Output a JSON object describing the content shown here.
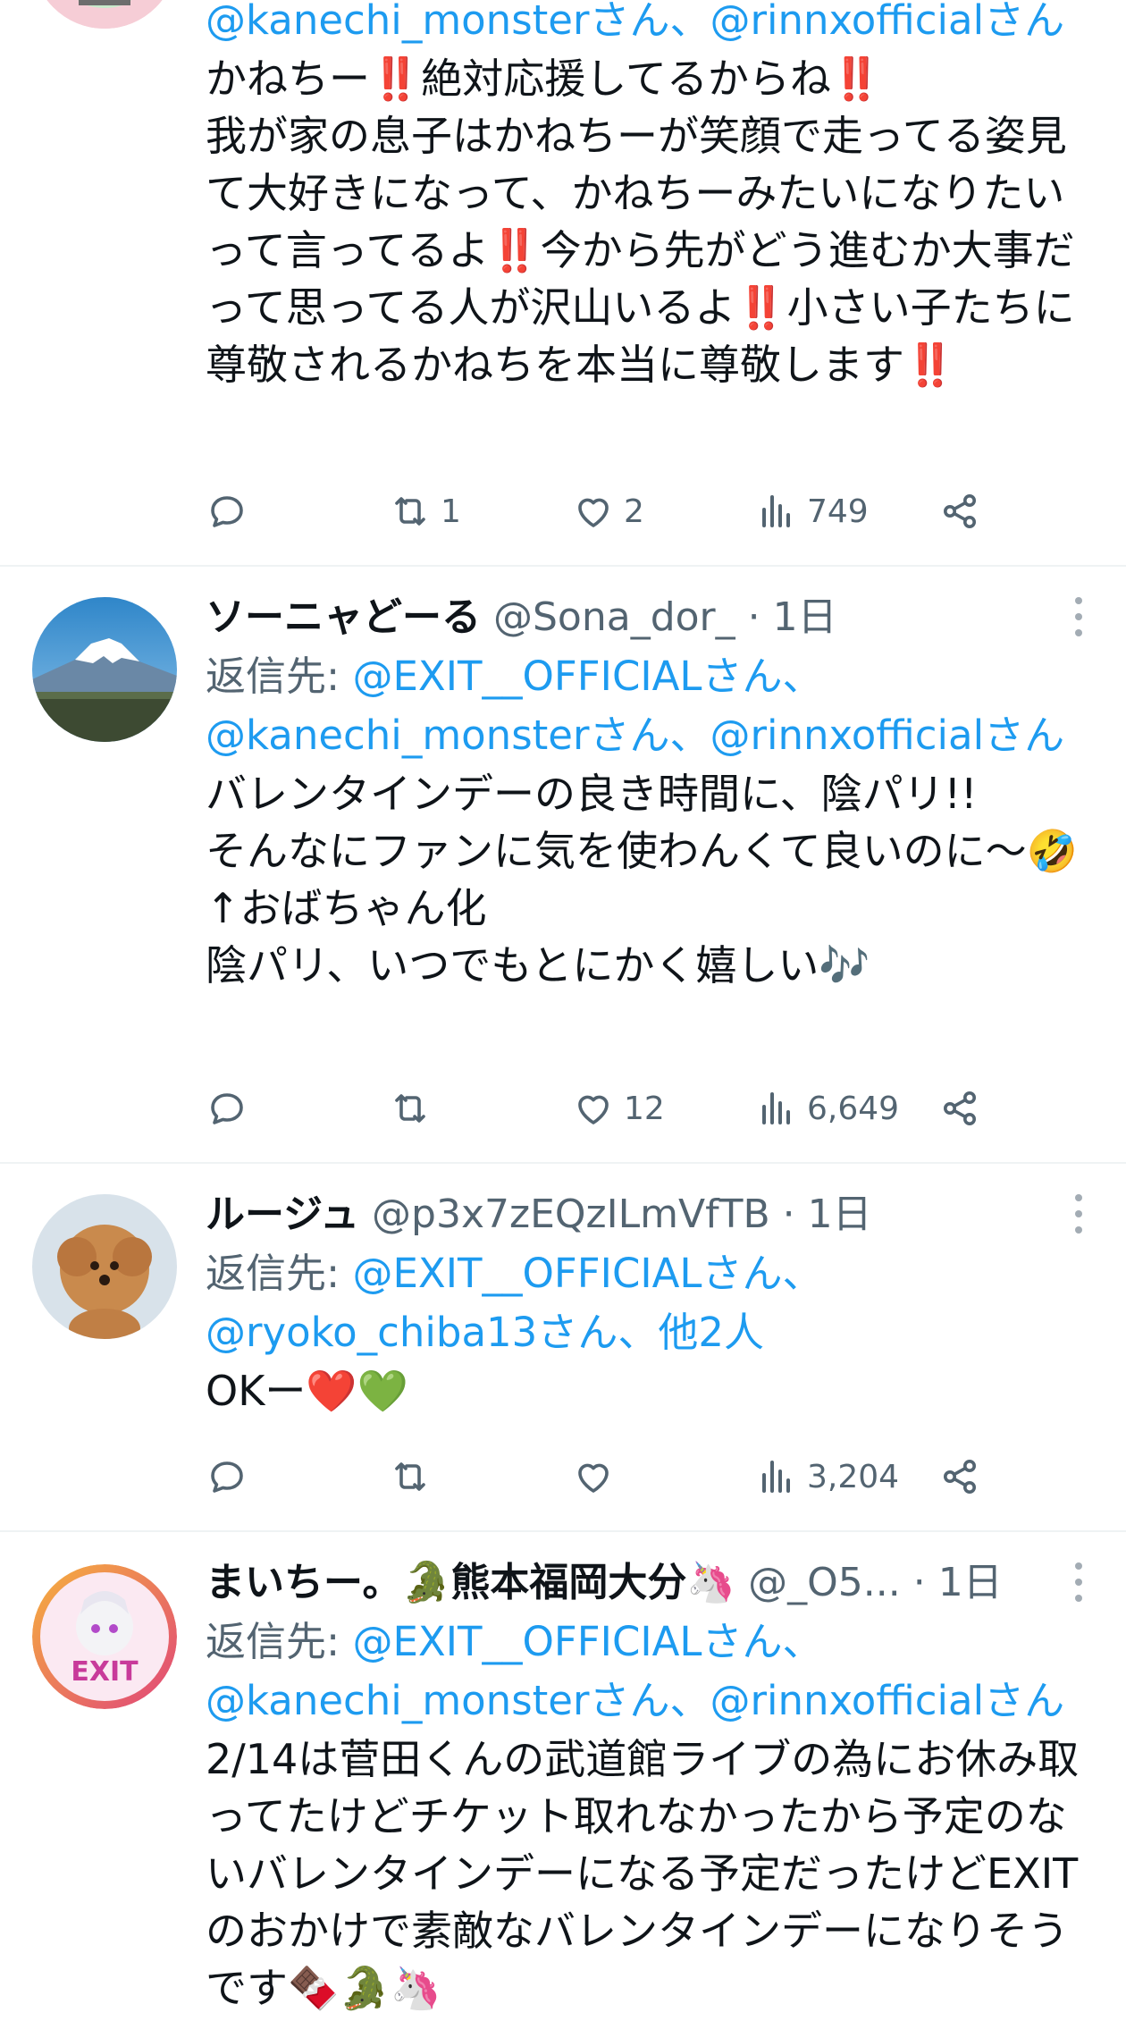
{
  "tweets": [
    {
      "reply_mentions_line2": "@kanechi_monsterさん、@rinnxofficialさん",
      "text": "かねちー‼️絶対応援してるからね‼️\n我が家の息子はかねちーが笑顔で走ってる姿見て大好きになって、かねちーみたいになりたいって言ってるよ‼️今から先がどう進むか大事だって思ってる人が沢山いるよ‼️小さい子たちに尊敬されるかねちを本当に尊敬します‼️",
      "actions": {
        "reply": "",
        "retweet": "1",
        "like": "2",
        "views": "749"
      }
    },
    {
      "name": "ソーニャどーる",
      "handle": "@Sona_dor_",
      "dot": "·",
      "time": "1日",
      "reply_prefix": "返信先: ",
      "reply_mentions_line1": "@EXIT__OFFICIALさん、",
      "reply_mentions_line2": "@kanechi_monsterさん、@rinnxofficialさん",
      "text": "バレンタインデーの良き時間に、陰パリ!!\nそんなにファンに気を使わんくて良いのに〜🤣\n↑おばちゃん化\n陰パリ、いつでもとにかく嬉しい🎶",
      "actions": {
        "reply": "",
        "retweet": "",
        "like": "12",
        "views": "6,649"
      }
    },
    {
      "name": "ルージュ",
      "handle": "@p3x7zEQzILmVfTB",
      "dot": "·",
      "time": "1日",
      "reply_prefix": "返信先: ",
      "reply_mentions_line1": "@EXIT__OFFICIALさん、",
      "reply_mentions_line2": "@ryoko_chiba13さん、他2人",
      "text": "OKー❤️💚",
      "actions": {
        "reply": "",
        "retweet": "",
        "like": "",
        "views": "3,204"
      }
    },
    {
      "name": "まいちー。🐊熊本福岡大分🦄",
      "handle": "@_O5...",
      "dot": "·",
      "time": "1日",
      "reply_prefix": "返信先: ",
      "reply_mentions_line1": "@EXIT__OFFICIALさん、",
      "reply_mentions_line2": "@kanechi_monsterさん、@rinnxofficialさん",
      "text": "2/14は菅田くんの武道館ライブの為にお休み取ってたけどチケット取れなかったから予定のないバレンタインデーになる予定だったけどEXITのおかけで素敵なバレンタインデーになりそうです🍫🐊🦄"
    }
  ],
  "colors": {
    "accent": "#1d9bf0",
    "muted": "#536471",
    "text": "#0f1419",
    "divider": "#eff3f4"
  },
  "icons": [
    "reply-icon",
    "retweet-icon",
    "like-icon",
    "views-icon",
    "share-icon",
    "more-icon"
  ]
}
